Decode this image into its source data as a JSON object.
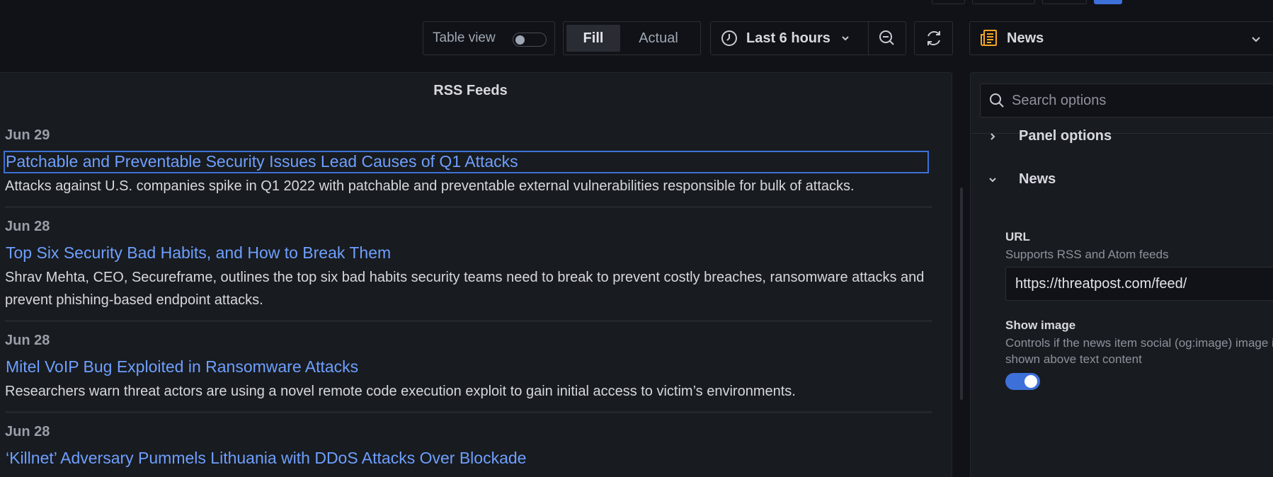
{
  "toolbar": {
    "table_view_label": "Table view",
    "table_view_on": false,
    "fill_label": "Fill",
    "actual_label": "Actual",
    "time_range": "Last 6 hours",
    "visualization": "News"
  },
  "panel": {
    "title": "RSS Feeds",
    "items": [
      {
        "date": "Jun 29",
        "title": "Patchable and Preventable Security Issues Lead Causes of Q1 Attacks",
        "description": "Attacks against U.S. companies spike in Q1 2022 with patchable and preventable external vulnerabilities responsible for bulk of attacks."
      },
      {
        "date": "Jun 28",
        "title": "Top Six Security Bad Habits, and How to Break Them",
        "description": "Shrav Mehta, CEO, Secureframe, outlines the top six bad habits security teams need to break to prevent costly breaches, ransomware attacks and prevent phishing-based endpoint attacks."
      },
      {
        "date": "Jun 28",
        "title": "Mitel VoIP Bug Exploited in Ransomware Attacks",
        "description": "Researchers warn threat actors are using a novel remote code execution exploit to gain initial access to victim’s environments."
      },
      {
        "date": "Jun 28",
        "title": "‘Killnet’ Adversary Pummels Lithuania with DDoS Attacks Over Blockade",
        "description": ""
      }
    ]
  },
  "options": {
    "search_placeholder": "Search options",
    "sections": {
      "panel_options": "Panel options",
      "news": "News"
    },
    "url_label": "URL",
    "url_description": "Supports RSS and Atom feeds",
    "url_value": "https://threatpost.com/feed/",
    "show_image_label": "Show image",
    "show_image_description": "Controls if the news item social (og:image) image is shown above text content",
    "show_image_on": true
  },
  "colors": {
    "background": "#111217",
    "panel": "#181b1f",
    "link": "#6e9fff",
    "accent": "#3d71d9",
    "visualization_icon": "#f5a623"
  }
}
